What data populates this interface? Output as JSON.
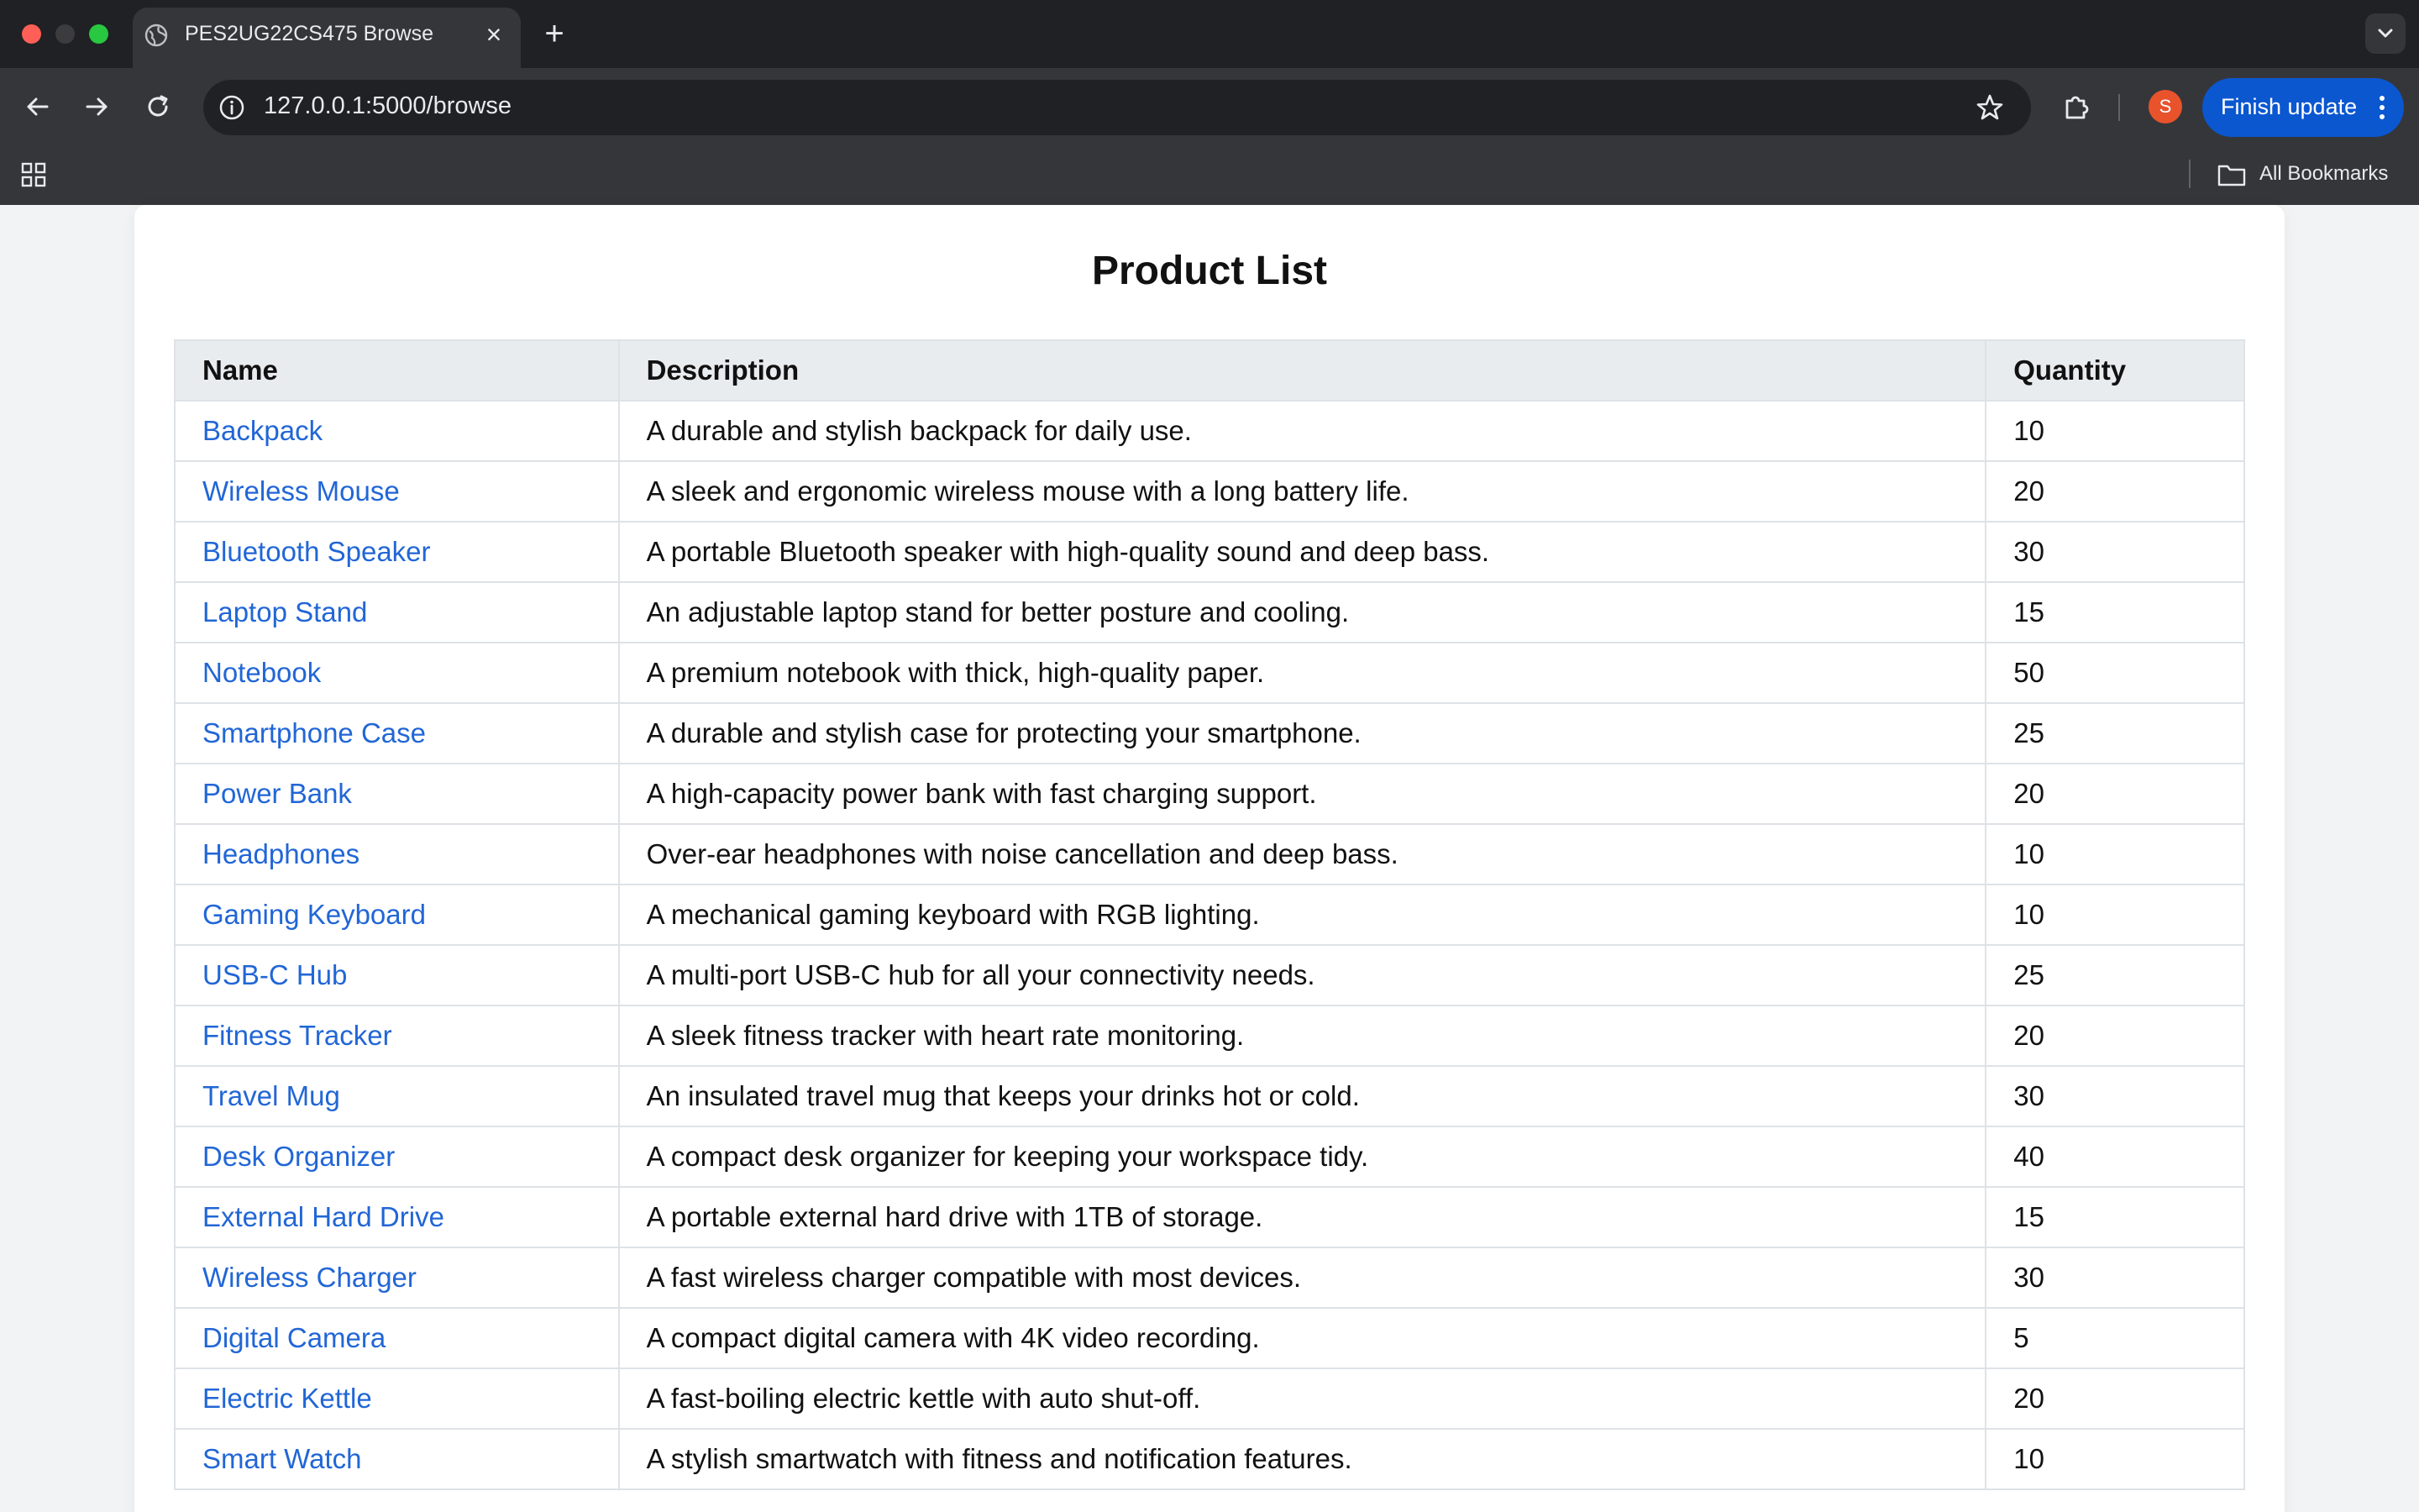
{
  "browser": {
    "tab_title": "PES2UG22CS475 Browse",
    "url": "127.0.0.1:5000/browse",
    "profile_initial": "S",
    "finish_update_label": "Finish update",
    "bookmarks_label": "All Bookmarks"
  },
  "page": {
    "title": "Product List",
    "columns": [
      "Name",
      "Description",
      "Quantity"
    ],
    "rows": [
      {
        "name": "Backpack",
        "description": "A durable and stylish backpack for daily use.",
        "quantity": "10"
      },
      {
        "name": "Wireless Mouse",
        "description": "A sleek and ergonomic wireless mouse with a long battery life.",
        "quantity": "20"
      },
      {
        "name": "Bluetooth Speaker",
        "description": "A portable Bluetooth speaker with high-quality sound and deep bass.",
        "quantity": "30"
      },
      {
        "name": "Laptop Stand",
        "description": "An adjustable laptop stand for better posture and cooling.",
        "quantity": "15"
      },
      {
        "name": "Notebook",
        "description": "A premium notebook with thick, high-quality paper.",
        "quantity": "50"
      },
      {
        "name": "Smartphone Case",
        "description": "A durable and stylish case for protecting your smartphone.",
        "quantity": "25"
      },
      {
        "name": "Power Bank",
        "description": "A high-capacity power bank with fast charging support.",
        "quantity": "20"
      },
      {
        "name": "Headphones",
        "description": "Over-ear headphones with noise cancellation and deep bass.",
        "quantity": "10"
      },
      {
        "name": "Gaming Keyboard",
        "description": "A mechanical gaming keyboard with RGB lighting.",
        "quantity": "10"
      },
      {
        "name": "USB-C Hub",
        "description": "A multi-port USB-C hub for all your connectivity needs.",
        "quantity": "25"
      },
      {
        "name": "Fitness Tracker",
        "description": "A sleek fitness tracker with heart rate monitoring.",
        "quantity": "20"
      },
      {
        "name": "Travel Mug",
        "description": "An insulated travel mug that keeps your drinks hot or cold.",
        "quantity": "30"
      },
      {
        "name": "Desk Organizer",
        "description": "A compact desk organizer for keeping your workspace tidy.",
        "quantity": "40"
      },
      {
        "name": "External Hard Drive",
        "description": "A portable external hard drive with 1TB of storage.",
        "quantity": "15"
      },
      {
        "name": "Wireless Charger",
        "description": "A fast wireless charger compatible with most devices.",
        "quantity": "30"
      },
      {
        "name": "Digital Camera",
        "description": "A compact digital camera with 4K video recording.",
        "quantity": "5"
      },
      {
        "name": "Electric Kettle",
        "description": "A fast-boiling electric kettle with auto shut-off.",
        "quantity": "20"
      },
      {
        "name": "Smart Watch",
        "description": "A stylish smartwatch with fitness and notification features.",
        "quantity": "10"
      }
    ]
  },
  "colors": {
    "link": "#2166d6",
    "header_bg": "#e9ecef",
    "chrome_dark": "#202124",
    "chrome_toolbar": "#35363a",
    "update_button": "#0b57d0",
    "avatar": "#e8532c"
  }
}
